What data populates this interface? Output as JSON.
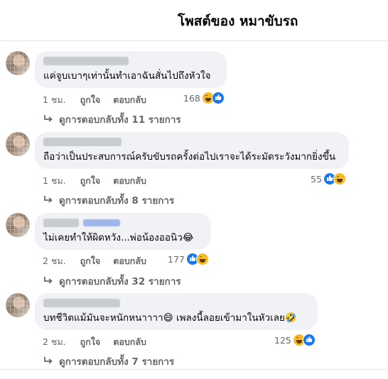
{
  "header": {
    "title": "โพสต์ของ หมาขับรถ"
  },
  "actions": {
    "like_label": "ถูกใจ",
    "reply_label": "ตอบกลับ"
  },
  "comments": [
    {
      "text": "แค่จูบเบาๆเท่านั้นทำเอาฉันสั่นไปถึงหัวใจ",
      "time": "1 ชม.",
      "reaction_count": "168",
      "reaction_icons": [
        "haha-icon",
        "like-icon"
      ],
      "replies_label": "ดูการตอบกลับทั้ง 11 รายการ"
    },
    {
      "text": "ถือว่าเป็นประสบการณ์ครับขับรถครั้งต่อไปเราจะได้ระมัดระวังมากยิ่งขึ้น",
      "time": "1 ชม.",
      "reaction_count": "55",
      "reaction_icons": [
        "like-icon",
        "haha-icon"
      ],
      "replies_label": "ดูการตอบกลับทั้ง 8 รายการ"
    },
    {
      "text": "ไม่เคยทำให้ผิดหวัง...พ่อน้องออนิว😂",
      "time": "2 ชม.",
      "reaction_count": "177",
      "reaction_icons": [
        "like-icon",
        "haha-icon"
      ],
      "replies_label": "ดูการตอบกลับทั้ง 32 รายการ"
    },
    {
      "text": "บทชีวิตแม้มันจะหนักหนาาาา😄 เพลงนี้ลอยเข้ามาในหัวเลย🤣",
      "time": "2 ชม.",
      "reaction_count": "125",
      "reaction_icons": [
        "haha-icon",
        "like-icon"
      ],
      "replies_label": "ดูการตอบกลับทั้ง 7 รายการ"
    }
  ]
}
